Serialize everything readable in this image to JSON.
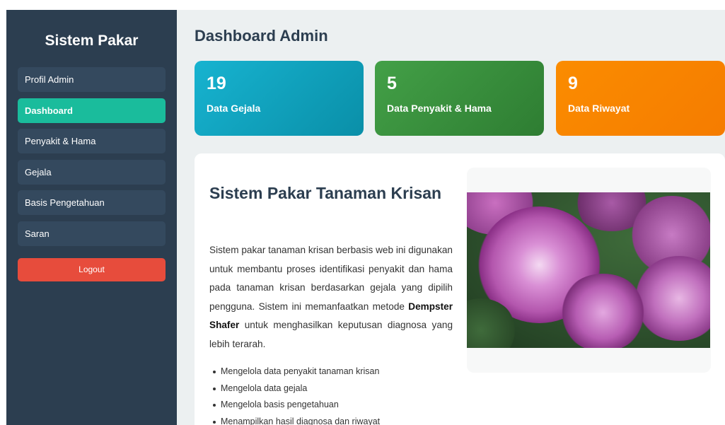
{
  "sidebar": {
    "brand": "Sistem Pakar",
    "items": [
      {
        "label": "Profil Admin"
      },
      {
        "label": "Dashboard"
      },
      {
        "label": "Penyakit & Hama"
      },
      {
        "label": "Gejala"
      },
      {
        "label": "Basis Pengetahuan"
      },
      {
        "label": "Saran"
      }
    ],
    "logout": "Logout"
  },
  "header": {
    "title": "Dashboard Admin"
  },
  "cards": [
    {
      "value": "19",
      "label": "Data Gejala"
    },
    {
      "value": "5",
      "label": "Data Penyakit & Hama"
    },
    {
      "value": "9",
      "label": "Data Riwayat"
    }
  ],
  "content": {
    "title": "Sistem Pakar Tanaman Krisan",
    "desc_before": "Sistem pakar tanaman krisan berbasis web ini digunakan untuk membantu proses identifikasi penyakit dan hama pada tanaman krisan berdasarkan gejala yang dipilih pengguna. Sistem ini memanfaatkan metode ",
    "desc_bold": "Dempster Shafer",
    "desc_after": " untuk menghasilkan keputusan diagnosa yang lebih terarah.",
    "features": [
      "Mengelola data penyakit tanaman krisan",
      "Mengelola data gejala",
      "Mengelola basis pengetahuan",
      "Menampilkan hasil diagnosa dan riwayat"
    ]
  },
  "colors": {
    "sidebar_bg": "#2c3e50",
    "nav_active": "#1abc9c",
    "logout": "#e74c3c",
    "card_gejala": "#17b3d0",
    "card_penyakit": "#43a047",
    "card_riwayat": "#fb8c00"
  }
}
